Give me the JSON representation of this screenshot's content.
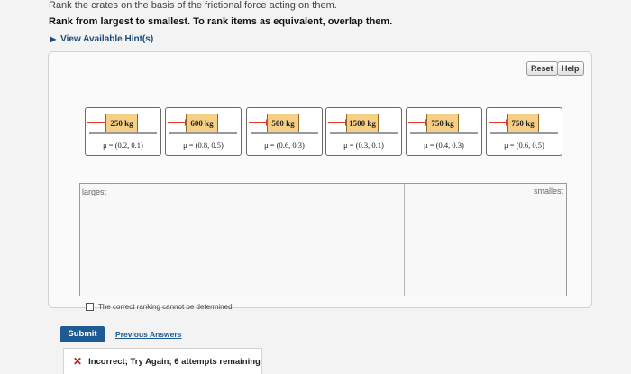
{
  "prompt": {
    "line1": "Rank the crates on the basis of the frictional force acting on them.",
    "line2": "Rank from largest to smallest. To rank items as equivalent, overlap them.",
    "hints_label": "View Available Hint(s)"
  },
  "toolbar": {
    "reset_label": "Reset",
    "help_label": "Help"
  },
  "crates": [
    {
      "mass": "250 kg",
      "mu": "μ = (0.2, 0.1)"
    },
    {
      "mass": "600 kg",
      "mu": "μ = (0.8, 0.5)"
    },
    {
      "mass": "500 kg",
      "mu": "μ = (0.6, 0.3)"
    },
    {
      "mass": "1500 kg",
      "mu": "μ = (0.3, 0.1)"
    },
    {
      "mass": "750 kg",
      "mu": "μ = (0.4, 0.3)"
    },
    {
      "mass": "750 kg",
      "mu": "μ = (0.6, 0.5)"
    }
  ],
  "ranking": {
    "largest_label": "largest",
    "smallest_label": "smallest"
  },
  "cannot_determine_label": "The correct ranking cannot be determined",
  "actions": {
    "submit_label": "Submit",
    "previous_label": "Previous Answers"
  },
  "feedback": {
    "message": "Incorrect; Try Again; 6 attempts remaining",
    "color": "#b22020"
  }
}
